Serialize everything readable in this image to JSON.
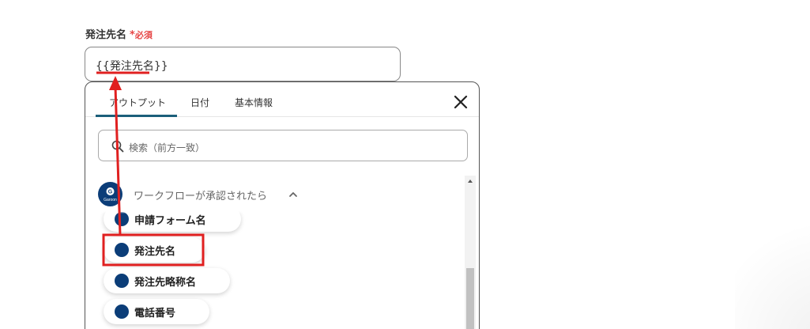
{
  "field": {
    "label": "発注先名",
    "required_mark": "*",
    "required_text": "必須",
    "value": "{{発注先名}}"
  },
  "popup": {
    "tabs": [
      {
        "label": "アウトプット",
        "active": true
      },
      {
        "label": "日付",
        "active": false
      },
      {
        "label": "基本情報",
        "active": false
      }
    ],
    "search_placeholder": "検索（前方一致）",
    "group": {
      "icon_name": "garoon-icon",
      "icon_text": "Garoon",
      "title": "ワークフローが承認されたら",
      "expanded": true
    },
    "items": [
      {
        "label": "申請フォーム名",
        "icon": "garoon-icon"
      },
      {
        "label": "発注先名",
        "icon": "garoon-icon",
        "highlighted": true
      },
      {
        "label": "発注先略称名",
        "icon": "garoon-icon"
      },
      {
        "label": "電話番号",
        "icon": "garoon-icon"
      }
    ]
  },
  "annotations": {
    "highlight_color": "#e02020",
    "arrow": "from highlighted item to input value"
  },
  "colors": {
    "accent": "#1b5f7a",
    "required": "#e64545",
    "garoon_blue": "#0b3d78"
  }
}
